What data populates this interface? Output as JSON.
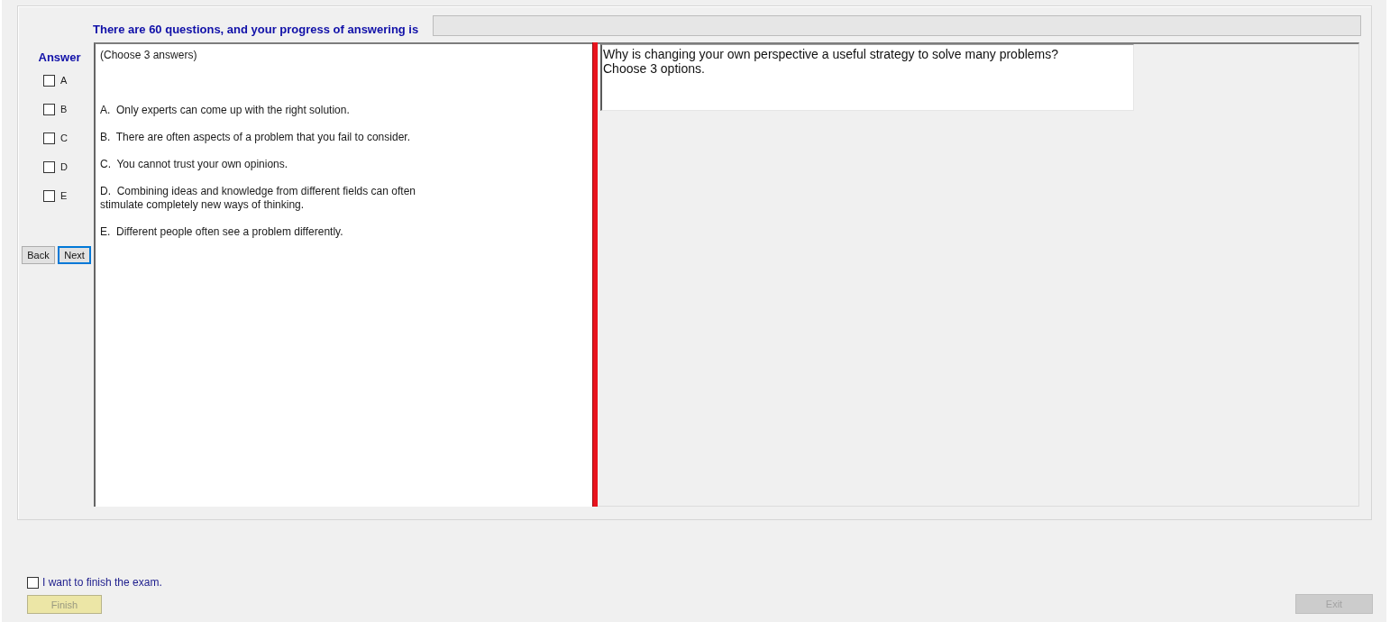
{
  "header": {
    "text": "There are 60 questions, and your progress of answering is",
    "progress": {
      "level": 0
    }
  },
  "answer_sheet": {
    "title": "Answer",
    "options": [
      {
        "label": "A",
        "checked": false
      },
      {
        "label": "B",
        "checked": false
      },
      {
        "label": "C",
        "checked": false
      },
      {
        "label": "D",
        "checked": false
      },
      {
        "label": "E",
        "checked": false
      }
    ],
    "buttons": [
      {
        "label": "Back",
        "focused": false
      },
      {
        "label": "Next",
        "focused": true
      }
    ]
  },
  "choices": {
    "instruction": "(Choose 3 answers)",
    "items": [
      "A.  Only experts can come up with the right solution.",
      "B.  There are often aspects of a problem that you fail to consider.",
      "C.  You cannot trust your own opinions.",
      "D.  Combining ideas and knowledge from different fields can often\nstimulate completely new ways of thinking.",
      "E.  Different people often see a problem differently."
    ]
  },
  "question": {
    "text": "Why is changing your own perspective a useful strategy to solve many problems?\nChoose 3 options."
  },
  "footer": {
    "finish_check": {
      "label": "I want to finish the exam.",
      "checked": false
    },
    "finish_button": {
      "label": "Finish",
      "disabled": true
    },
    "exit_button": {
      "label": "Exit",
      "disabled": true
    }
  }
}
